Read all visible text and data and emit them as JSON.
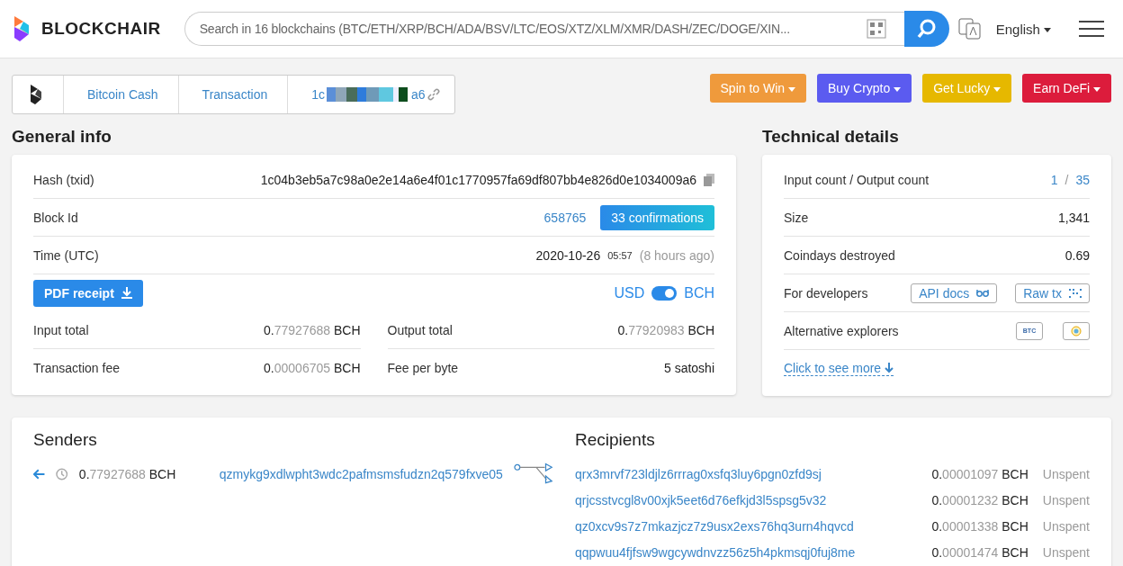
{
  "header": {
    "brand": "BLOCKCHAIR",
    "search": {
      "placeholder": "Search in 16 blockchains (BTC/ETH/XRP/BCH/ADA/BSV/LTC/EOS/XTZ/XLM/XMR/DASH/ZEC/DOGE/XIN..."
    },
    "language": "English"
  },
  "breadcrumb": {
    "items": [
      "Bitcoin Cash",
      "Transaction"
    ],
    "hash_start": "1c",
    "hash_end": "a6"
  },
  "promo_buttons": [
    {
      "label": "Spin to Win",
      "color": "#ef9a3c"
    },
    {
      "label": "Buy Crypto",
      "color": "#5b5bf0"
    },
    {
      "label": "Get Lucky",
      "color": "#e6b800"
    },
    {
      "label": "Earn DeFi",
      "color": "#dc1c3c"
    }
  ],
  "general_info": {
    "title": "General info",
    "hash": {
      "label": "Hash (txid)",
      "value": "1c04b3eb5a7c98a0e2e14a6e4f01c1770957fa69df807bb4e826d0e1034009a6"
    },
    "block": {
      "label": "Block Id",
      "value": "658765",
      "badge": "33 confirmations"
    },
    "time": {
      "label": "Time (UTC)",
      "date": "2020-10-26",
      "clock": "05:57",
      "ago": "(8 hours ago)"
    },
    "pdf_button": "PDF receipt",
    "currency_toggle": {
      "left": "USD",
      "right": "BCH",
      "on": true
    },
    "totals": [
      {
        "label": "Input total",
        "lead": "0.",
        "rest": "77927688",
        "unit": "BCH"
      },
      {
        "label": "Output total",
        "lead": "0.",
        "rest": "77920983",
        "unit": "BCH"
      },
      {
        "label": "Transaction fee",
        "lead": "0.",
        "rest": "00006705",
        "unit": "BCH"
      },
      {
        "label": "Fee per byte",
        "lead": "5 satoshi"
      }
    ]
  },
  "technical_details": {
    "title": "Technical details",
    "rows": [
      {
        "label": "Input count / Output count",
        "input_count": "1",
        "separator": "/",
        "output_count": "35"
      },
      {
        "label": "Size",
        "value": "1,341"
      },
      {
        "label": "Coindays destroyed",
        "value": "0.69"
      }
    ],
    "developers": {
      "label": "For developers",
      "buttons": [
        "API docs",
        "Raw tx"
      ]
    },
    "explorers": {
      "label": "Alternative explorers",
      "badge": "BTC"
    },
    "more_link": "Click to see more"
  },
  "senders": {
    "title": "Senders",
    "rows": [
      {
        "lead": "0.",
        "rest": "77927688",
        "unit": "BCH",
        "address": "qzmykg9xdlwpht3wdc2pafmsmsfudzn2q579fxve05"
      }
    ]
  },
  "recipients": {
    "title": "Recipients",
    "rows": [
      {
        "address": "qrx3mrvf723ldjlz6rrrag0xsfq3luy6pgn0zfd9sj",
        "lead": "0.",
        "rest": "00001097",
        "unit": "BCH",
        "status": "Unspent"
      },
      {
        "address": "qrjcsstvcgl8v00xjk5eet6d76efkjd3l5spsg5v32",
        "lead": "0.",
        "rest": "00001232",
        "unit": "BCH",
        "status": "Unspent"
      },
      {
        "address": "qz0xcv9s7z7mkazjcz7z9usx2exs76hq3urn4hqvcd",
        "lead": "0.",
        "rest": "00001338",
        "unit": "BCH",
        "status": "Unspent"
      },
      {
        "address": "qqpwuu4fjfsw9wgcywdnvzz56z5h4pkmsqj0fuj8me",
        "lead": "0.",
        "rest": "00001474",
        "unit": "BCH",
        "status": "Unspent"
      }
    ]
  }
}
